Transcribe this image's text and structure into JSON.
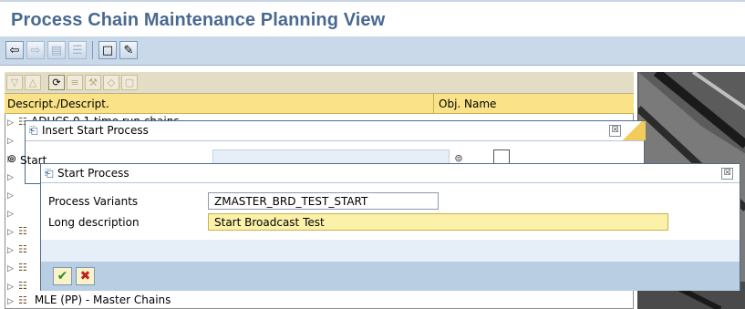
{
  "title": "Process Chain Maintenance Planning View",
  "toolbar": {
    "buttons": [
      {
        "name": "back-icon",
        "glyph": "⇦",
        "enabled": true
      },
      {
        "name": "forward-icon",
        "glyph": "⇨",
        "enabled": false
      },
      {
        "name": "panel-icon",
        "glyph": "▤",
        "enabled": false
      },
      {
        "name": "tree-icon",
        "glyph": "☰",
        "enabled": false
      },
      {
        "name": "new-page-icon",
        "glyph": "□",
        "enabled": true
      },
      {
        "name": "edit-pen-icon",
        "glyph": "✎",
        "enabled": true
      }
    ]
  },
  "tree": {
    "col1_header": "Descript./Descript.",
    "col2_header": "Obj. Name",
    "rows": [
      {
        "text": "ADUCS 0.1 time run chains"
      },
      {
        "text": ""
      },
      {
        "text": "Start"
      },
      {
        "text": ""
      },
      {
        "text": ""
      },
      {
        "text": ""
      },
      {
        "text": ""
      },
      {
        "text": ""
      },
      {
        "text": ""
      },
      {
        "text": ""
      },
      {
        "text": "MLE (PP) - Master Chains"
      }
    ]
  },
  "insert_dialog": {
    "title": "Insert Start Process",
    "field_label": "Start",
    "close_label": "☒"
  },
  "start_dialog": {
    "title": "Start Process",
    "close_label": "☒",
    "fields": [
      {
        "label": "Process Variants",
        "value": "ZMASTER_BRD_TEST_START"
      },
      {
        "label": "Long description",
        "value": "Start Broadcast Test"
      }
    ],
    "ok_glyph": "✔",
    "cancel_glyph": "✖"
  },
  "colors": {
    "title_text": "#4a6990",
    "toolbar_bg": "#cad9ea",
    "header_yellow": "#f9e287",
    "input_yellow": "#fbf1a8"
  }
}
